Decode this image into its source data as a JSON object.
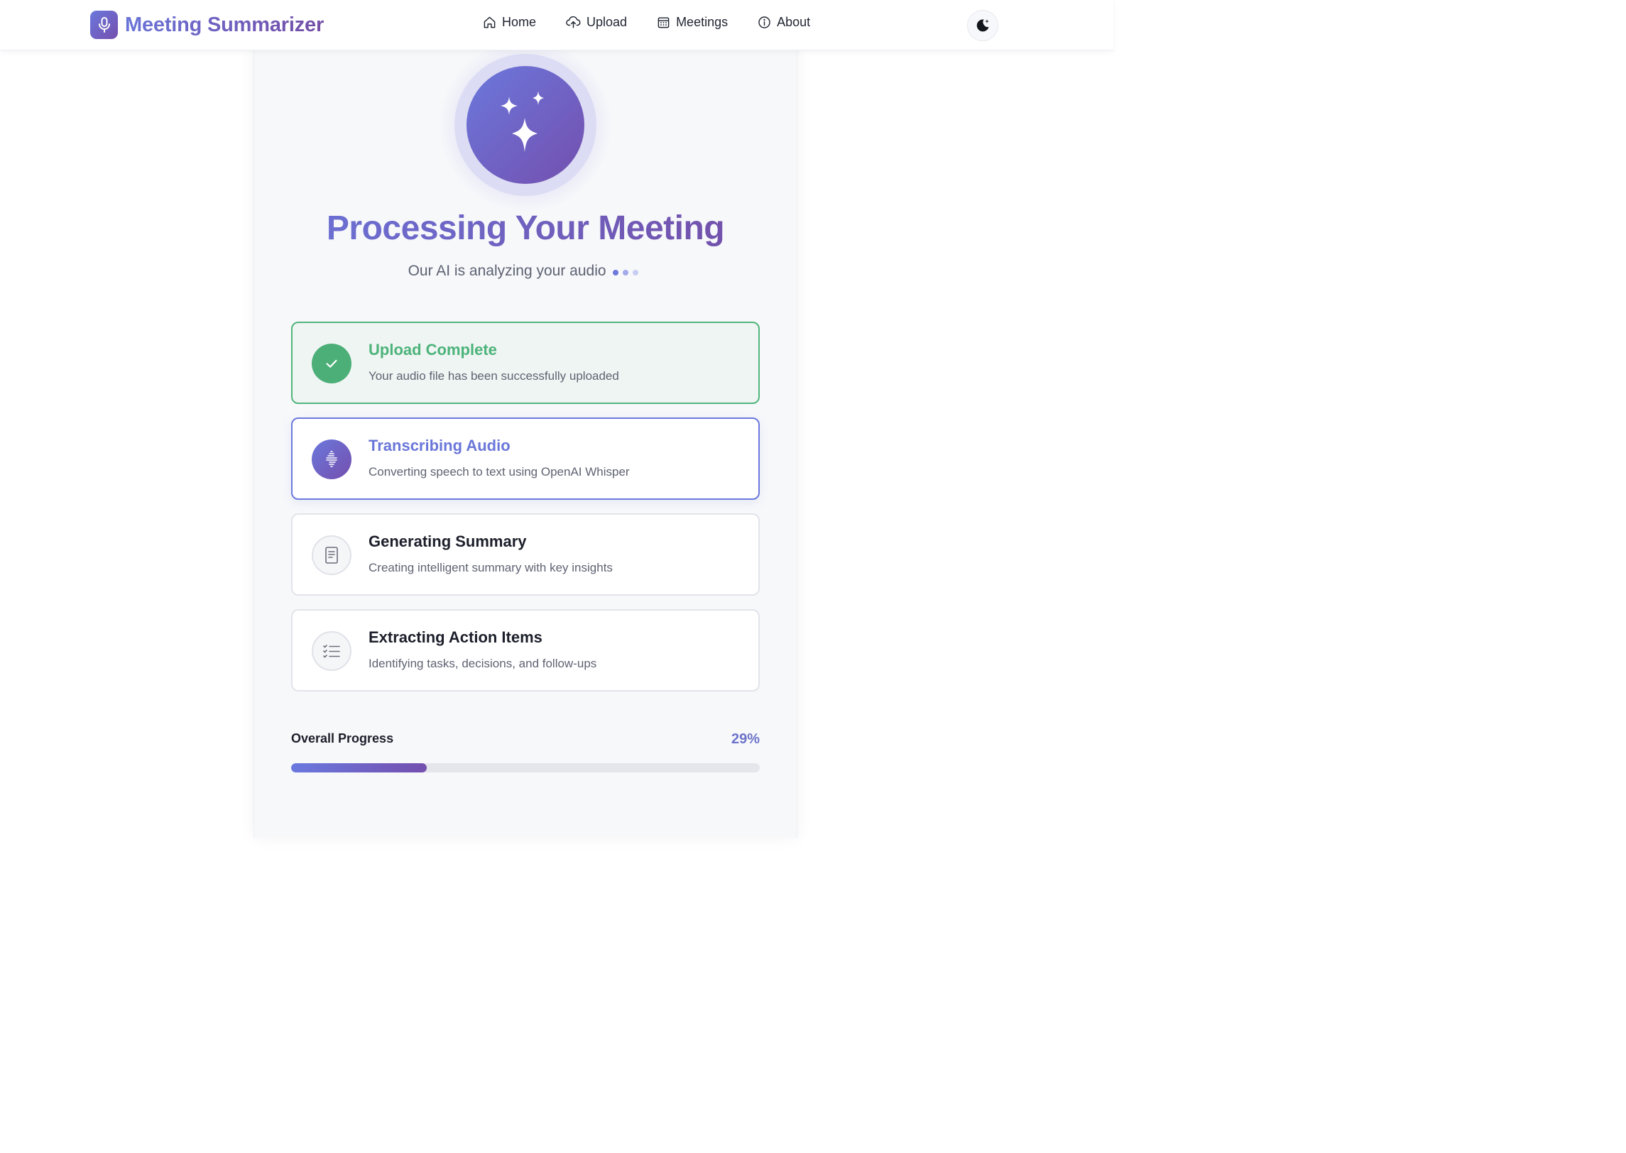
{
  "app": {
    "name": "Meeting Summarizer",
    "logo_icon": "microphone-icon"
  },
  "nav": {
    "items": [
      {
        "label": "Home",
        "icon": "home-icon"
      },
      {
        "label": "Upload",
        "icon": "cloud-upload-icon"
      },
      {
        "label": "Meetings",
        "icon": "calendar-icon"
      },
      {
        "label": "About",
        "icon": "info-icon"
      }
    ],
    "theme_toggle_icon": "moon-stars-icon"
  },
  "hero": {
    "icon": "sparkles-icon",
    "title": "Processing Your Meeting",
    "subtitle": "Our AI is analyzing your audio"
  },
  "steps": [
    {
      "title": "Upload Complete",
      "description": "Your audio file has been successfully uploaded",
      "status": "done",
      "icon": "check-icon"
    },
    {
      "title": "Transcribing Audio",
      "description": "Converting speech to text using OpenAI Whisper",
      "status": "active",
      "icon": "waveform-icon"
    },
    {
      "title": "Generating Summary",
      "description": "Creating intelligent summary with key insights",
      "status": "pending",
      "icon": "document-icon"
    },
    {
      "title": "Extracting Action Items",
      "description": "Identifying tasks, decisions, and follow-ups",
      "status": "pending",
      "icon": "checklist-icon"
    }
  ],
  "progress": {
    "label": "Overall Progress",
    "value_text": "29%",
    "value": 0.29
  },
  "colors": {
    "brand_start": "#6b78dc",
    "brand_end": "#744fae",
    "success": "#4caf78",
    "track": "#e5e6ec"
  }
}
